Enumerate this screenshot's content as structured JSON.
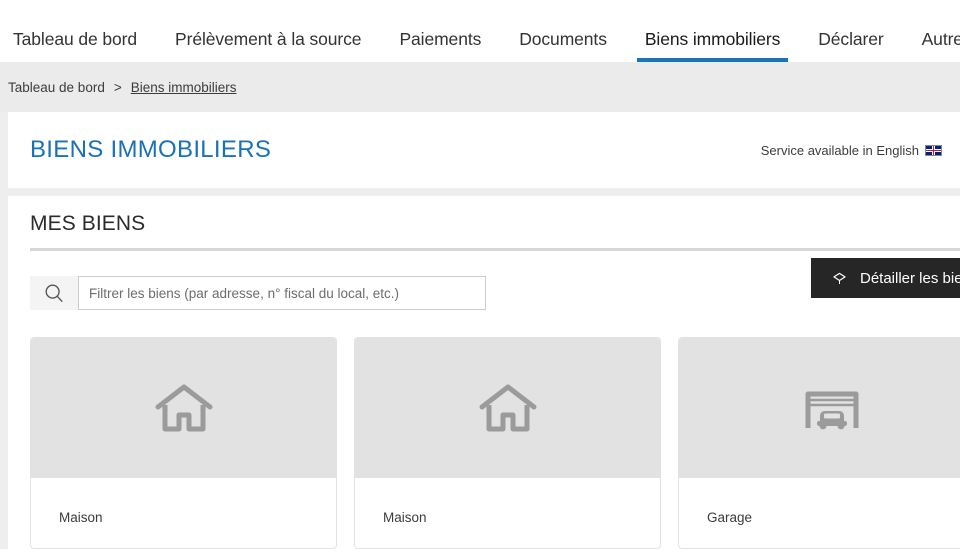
{
  "nav": {
    "items": [
      {
        "label": "Tableau de bord",
        "active": false
      },
      {
        "label": "Prélèvement à la source",
        "active": false
      },
      {
        "label": "Paiements",
        "active": false
      },
      {
        "label": "Documents",
        "active": false
      },
      {
        "label": "Biens immobiliers",
        "active": true
      },
      {
        "label": "Déclarer",
        "active": false
      },
      {
        "label": "Autres servi",
        "active": false
      }
    ],
    "active_underline_color": "#1975b8"
  },
  "breadcrumb": {
    "root": "Tableau de bord",
    "separator": ">",
    "current": "Biens immobiliers"
  },
  "header": {
    "title": "BIENS IMMOBILIERS",
    "title_color": "#1a71b8",
    "english_link": "Service available in English",
    "flag_icon": "uk-flag-icon"
  },
  "main": {
    "section_title": "MES BIENS",
    "search": {
      "placeholder": "Filtrer les biens (par adresse, n° fiscal du local, etc.)",
      "value": "",
      "icon": "search-icon"
    },
    "detail_button": {
      "label": "Détailler les biens",
      "icon": "hexagon-icon",
      "background": "#262626"
    },
    "cards": [
      {
        "type_icon": "house-icon",
        "label": "Maison"
      },
      {
        "type_icon": "house-icon",
        "label": "Maison"
      },
      {
        "type_icon": "garage-icon",
        "label": "Garage"
      }
    ]
  }
}
